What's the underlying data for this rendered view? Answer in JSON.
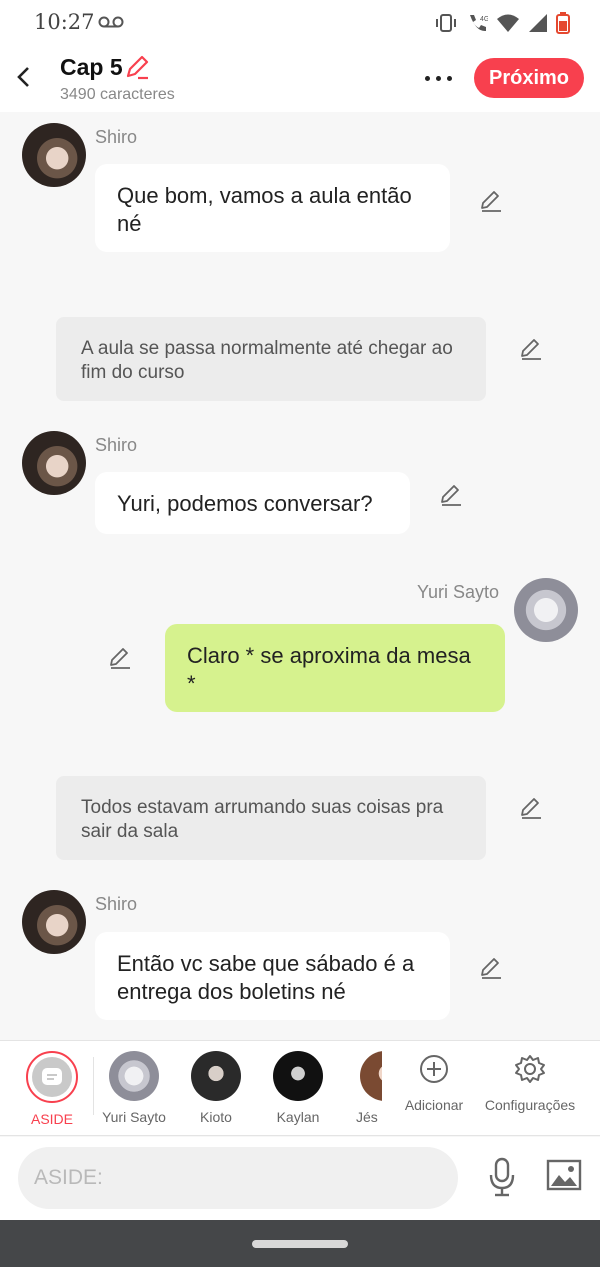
{
  "status_bar": {
    "time": "10:27",
    "network": "4G"
  },
  "header": {
    "title": "Cap 5",
    "subtitle": "3490 caracteres",
    "next_label": "Próximo"
  },
  "messages": [
    {
      "sender": "Shiro",
      "text": "Que bom, vamos a aula então né"
    },
    {
      "narration": "A aula se passa normalmente até chegar ao fim do curso"
    },
    {
      "sender": "Shiro",
      "text": "Yuri, podemos conversar?"
    },
    {
      "sender": "Yuri Sayto",
      "text": "Claro * se aproxima da mesa *"
    },
    {
      "narration": "Todos estavam arrumando suas coisas pra sair da sala"
    },
    {
      "sender": "Shiro",
      "text": "Então vc sabe que sábado é a entrega dos boletins né"
    }
  ],
  "character_bar": {
    "aside": "ASIDE",
    "characters": [
      "Yuri Sayto",
      "Kioto",
      "Kaylan",
      "Jés"
    ],
    "add_label": "Adicionar",
    "settings_label": "Configurações"
  },
  "input": {
    "placeholder": "ASIDE:"
  },
  "colors": {
    "accent": "#f8404e",
    "my_bubble": "#d6f28e",
    "narration_bg": "#ececec"
  }
}
